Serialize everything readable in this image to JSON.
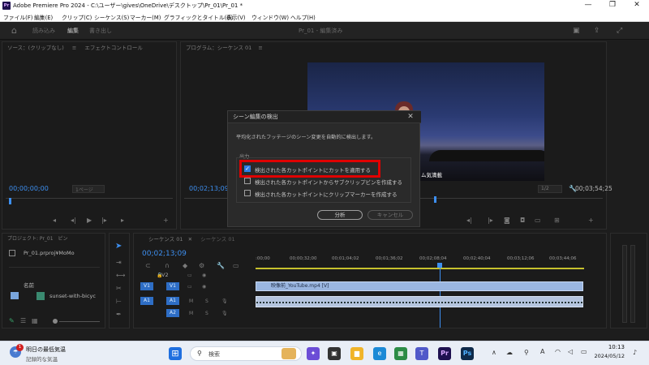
{
  "window": {
    "title": "Adobe Premiere Pro 2024 - C:\\ユーザー\\gives\\OneDrive\\デスクトップ\\Pr_01\\Pr_01 *",
    "app_icon": "Pr"
  },
  "menu": [
    "ファイル(F)",
    "編集(E)",
    "クリップ(C)",
    "シーケンス(S)",
    "マーカー(M)",
    "グラフィックとタイトル(G)",
    "表示(V)",
    "ウィンドウ(W)",
    "ヘルプ(H)"
  ],
  "workspace": {
    "tabs": [
      "読み込み",
      "編集",
      "書き出し"
    ],
    "active_tab": "編集",
    "project_title": "Pr_01 - 編集済み"
  },
  "source_panel": {
    "tabs": [
      "ソース：(クリップなし)",
      "エフェクトコントロール"
    ],
    "timecode": "00;00;00;00",
    "page": "1ページ"
  },
  "program_panel": {
    "tab": "プログラム：シーケンス 01",
    "timecode_left": "00;02;13;09",
    "timecode_right": "00;03;54;25",
    "zoom": "1/2",
    "caption_text": "ム気満載"
  },
  "project_panel": {
    "tab1": "プロジェクト: Pr_01",
    "tab2": "ピン",
    "file": "Pr_01.prproj¥MoMo",
    "col_name": "名前",
    "item": "sunset-with-bicyc"
  },
  "timeline": {
    "tabs": [
      "シーケンス 01",
      "シーケンス 01"
    ],
    "timecode": "00;02;13;09",
    "ruler": [
      ":00;00",
      "00;00;32;00",
      "00;01;04;02",
      "00;01;36;02",
      "00;02;08;04",
      "00;02;40;04",
      "00;03;12;06",
      "00;03;44;06"
    ],
    "tracks": [
      {
        "src": "",
        "name": "V2"
      },
      {
        "src": "V1",
        "name": "V1"
      },
      {
        "src": "A1",
        "name": "A1"
      },
      {
        "src": "",
        "name": "A2"
      }
    ],
    "video_clip": "映像前_YouTube.mp4 [V]"
  },
  "dialog": {
    "title": "シーン編集の検出",
    "description": "平均化されたフッテージのシーン変更を自動的に検出します。",
    "section": "出力",
    "options": [
      {
        "label": "検出された各カットポイントにカットを適用する",
        "checked": true
      },
      {
        "label": "検出された各カットポイントからサブクリップビンを作成する",
        "checked": false
      },
      {
        "label": "検出された各カットポイントにクリップマーカーを作成する",
        "checked": false
      }
    ],
    "analyze_button": "分析",
    "cancel_button": "キャンセル"
  },
  "taskbar": {
    "weather_title": "明日の最低気温",
    "weather_sub": "記録的な気温",
    "weather_badge": "1",
    "search_placeholder": "検索",
    "time": "10:13",
    "date": "2024/05/12",
    "ime": "A"
  },
  "colors": {
    "accent": "#2d7de6",
    "highlight": "#e00000",
    "clip": "#9ab6e0"
  }
}
